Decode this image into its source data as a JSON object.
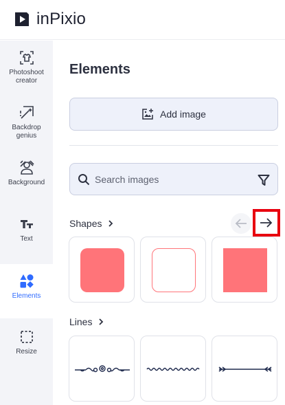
{
  "app": {
    "brand": "inPixio"
  },
  "colors": {
    "accent": "#2f6bff",
    "shape_fill": "#ff7479",
    "highlight": "#e8000f"
  },
  "sidebar": {
    "items": [
      {
        "label": "Photoshoot creator",
        "icon": "photoshoot-icon",
        "active": false
      },
      {
        "label": "Backdrop genius",
        "icon": "backdrop-icon",
        "active": false
      },
      {
        "label": "Background",
        "icon": "background-icon",
        "active": false
      },
      {
        "label": "Text",
        "icon": "text-icon",
        "active": false
      },
      {
        "label": "Elements",
        "icon": "elements-icon",
        "active": true
      },
      {
        "label": "Resize",
        "icon": "resize-icon",
        "active": false
      }
    ]
  },
  "panel": {
    "title": "Elements",
    "add_image_label": "Add image",
    "search": {
      "placeholder": "Search images",
      "value": ""
    },
    "shapes": {
      "heading": "Shapes",
      "items": [
        "filled-rounded-square",
        "outlined-rounded-square",
        "filled-square"
      ]
    },
    "lines": {
      "heading": "Lines",
      "items": [
        "ornamental-line",
        "wavy-line",
        "arrow-line"
      ]
    }
  }
}
